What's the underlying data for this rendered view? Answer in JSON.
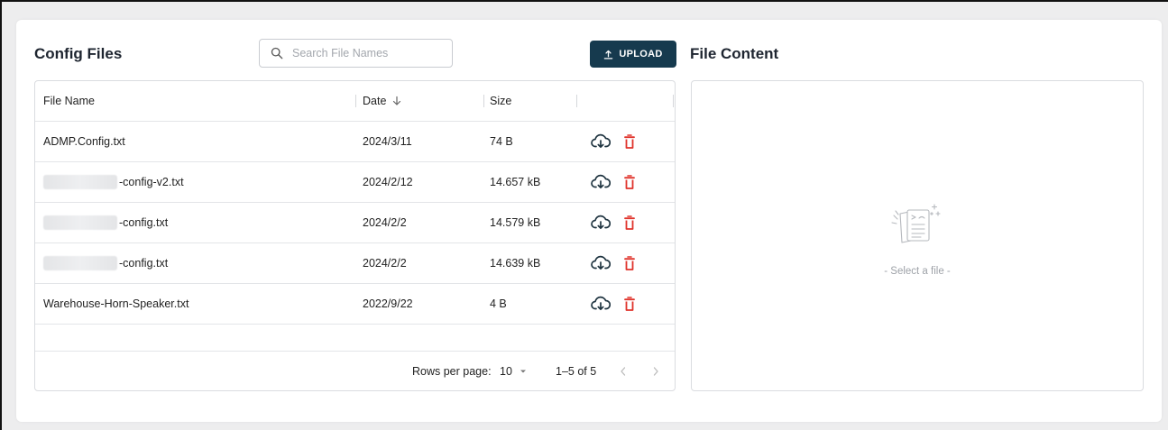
{
  "config_files": {
    "title": "Config Files",
    "search_placeholder": "Search File Names",
    "upload_label": "UPLOAD",
    "columns": {
      "name": "File Name",
      "date": "Date",
      "size": "Size"
    },
    "rows": [
      {
        "name": "ADMP.Config.txt",
        "date": "2024/3/11",
        "size": "74 B",
        "redacted": false
      },
      {
        "name": "-config-v2.txt",
        "date": "2024/2/12",
        "size": "14.657 kB",
        "redacted": true
      },
      {
        "name": "-config.txt",
        "date": "2024/2/2",
        "size": "14.579 kB",
        "redacted": true
      },
      {
        "name": "-config.txt",
        "date": "2024/2/2",
        "size": "14.639 kB",
        "redacted": true
      },
      {
        "name": "Warehouse-Horn-Speaker.txt",
        "date": "2022/9/22",
        "size": "4 B",
        "redacted": false
      }
    ],
    "pagination": {
      "rows_per_page_label": "Rows per page:",
      "rows_per_page_value": "10",
      "range": "1–5 of 5"
    }
  },
  "file_content": {
    "title": "File Content",
    "empty_text": "- Select a file -"
  },
  "colors": {
    "primary": "#163a4e",
    "delete": "#e0332b",
    "download": "#1f3440",
    "background": "#ededee"
  },
  "icons": {
    "search": "search-icon",
    "upload": "upload-icon",
    "sort": "arrow-down-icon",
    "download": "cloud-download-icon",
    "delete": "trash-icon",
    "dropdown": "caret-down-icon",
    "prev": "chevron-left-icon",
    "next": "chevron-right-icon",
    "empty": "empty-document-icon"
  }
}
